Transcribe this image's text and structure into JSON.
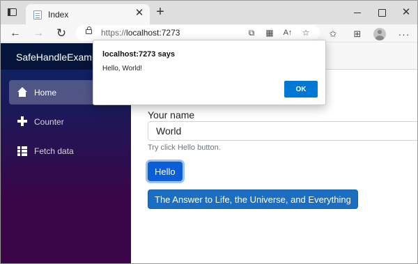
{
  "browser": {
    "tab": {
      "title": "Index",
      "close": "✕"
    },
    "new_tab": "+",
    "window_controls": {
      "close": "✕"
    },
    "nav": {
      "back": "←",
      "forward": "→",
      "refresh": "↻"
    },
    "url_prefix": "https://",
    "url_host": "localhost:7273",
    "icons": [
      "lock-icon",
      "app-available-icon",
      "qr-code-icon",
      "read-aloud-icon",
      "add-favorite-icon",
      "favorites-icon",
      "collections-icon",
      "profile-avatar",
      "more-icon"
    ],
    "icon_glyphs": {
      "app": "⧉",
      "qr": "▦",
      "read": "A↑",
      "fav_add": "☆",
      "favorites": "✩",
      "collections": "⊞",
      "more": "···"
    }
  },
  "app": {
    "brand": "SafeHandleExample",
    "sidebar": {
      "items": [
        {
          "label": "Home",
          "icon": "home-icon",
          "active": true
        },
        {
          "label": "Counter",
          "icon": "plus-icon",
          "active": false
        },
        {
          "label": "Fetch data",
          "icon": "list-icon",
          "active": false
        }
      ]
    },
    "form": {
      "label": "Your name",
      "value": "World",
      "hint": "Try click Hello button.",
      "hello_button": "Hello",
      "answer_button": "The Answer to Life, the Universe, and Everything"
    }
  },
  "dialog": {
    "title": "localhost:7273 says",
    "message": "Hello, World!",
    "ok": "OK"
  },
  "colors": {
    "primary_button": "#1b6ec2",
    "dialog_ok": "#0078d4",
    "sidebar_top": "#052767",
    "sidebar_bottom": "#3a0647"
  }
}
